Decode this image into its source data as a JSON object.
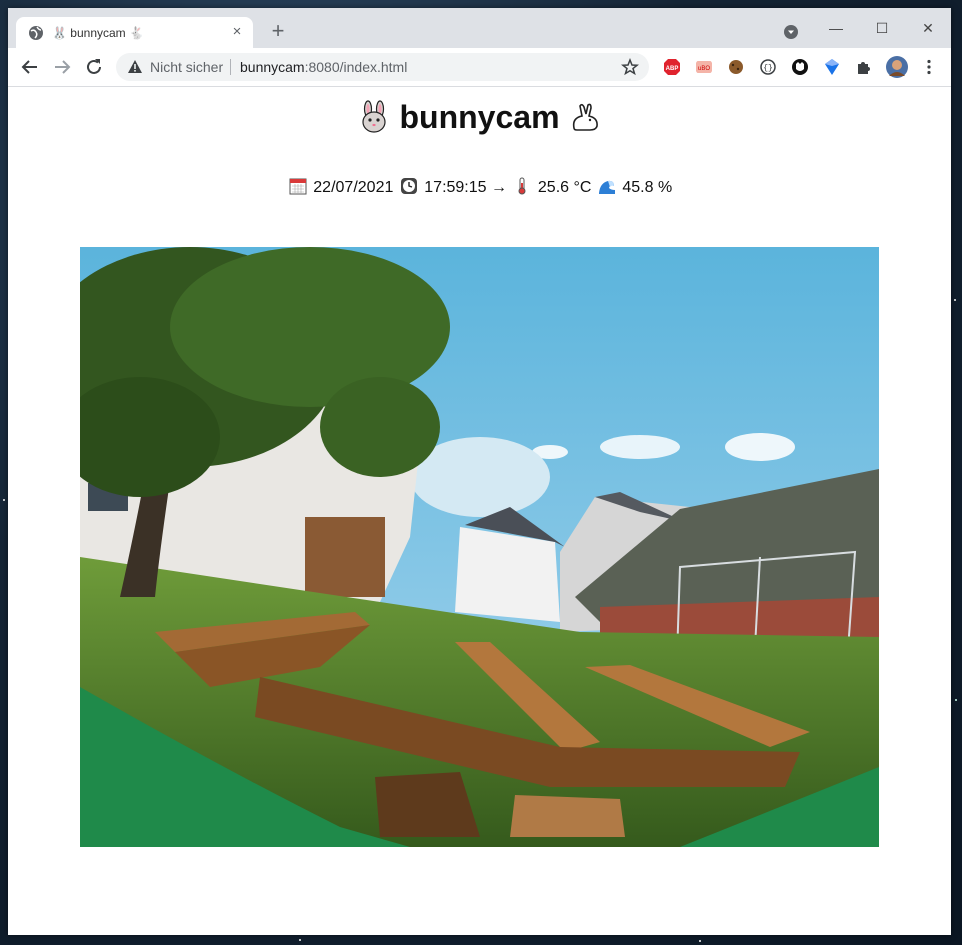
{
  "browser": {
    "tab_title": "bunnycam",
    "new_tab_label": "+",
    "close_label": "×",
    "security_label": "Nicht sicher",
    "url_host": "bunnycam",
    "url_path": ":8080/index.html",
    "window_controls": {
      "minimize": "—",
      "maximize": "☐",
      "close": "✕"
    },
    "extension_icons": [
      "abp-icon",
      "ublock-icon",
      "cookie-icon",
      "privacy-icon",
      "github-icon",
      "bookmark-icon",
      "puzzle-icon",
      "profile-avatar"
    ],
    "colors": {
      "tabbar": "#dee1e6",
      "omnibox": "#f1f3f4"
    }
  },
  "page": {
    "title": "bunnycam",
    "date": "22/07/2021",
    "time": "17:59:15",
    "arrow": "→",
    "temperature": "25.6 °C",
    "humidity": "45.8 %",
    "icons": [
      "rabbit-face-icon",
      "rabbit-icon",
      "calendar-icon",
      "clock-icon",
      "thermometer-icon",
      "wave-icon"
    ],
    "camera_image": "webcam snapshot of a garden with wooden benches"
  }
}
